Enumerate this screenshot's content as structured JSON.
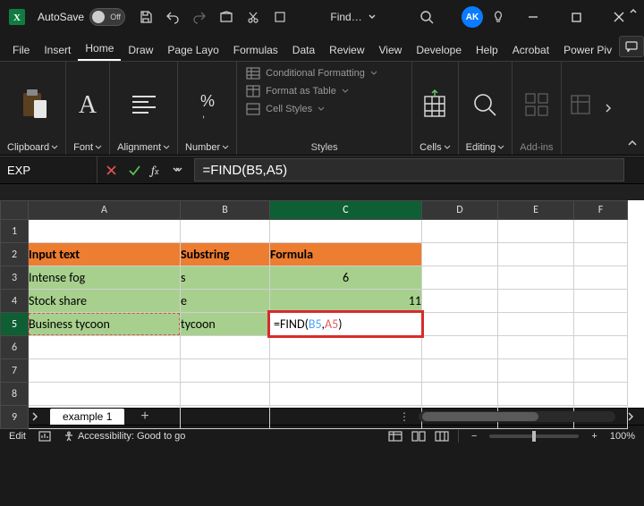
{
  "titlebar": {
    "autosave_label": "AutoSave",
    "autosave_state": "Off",
    "doc_title": "Find…",
    "user_initials": "AK"
  },
  "tabs": {
    "items": [
      "File",
      "Insert",
      "Home",
      "Draw",
      "Page Layo",
      "Formulas",
      "Data",
      "Review",
      "View",
      "Develope",
      "Help",
      "Acrobat",
      "Power Piv"
    ],
    "active_index": 2
  },
  "ribbon": {
    "clipboard": "Clipboard",
    "font": "Font",
    "alignment": "Alignment",
    "number": "Number",
    "styles_label": "Styles",
    "cond_fmt": "Conditional Formatting",
    "fmt_table": "Format as Table",
    "cell_styles": "Cell Styles",
    "cells": "Cells",
    "editing": "Editing",
    "addins": "Add-ins"
  },
  "namebox": {
    "value": "EXP"
  },
  "formula_bar": {
    "value": "=FIND(B5,A5)"
  },
  "grid": {
    "columns": [
      "A",
      "B",
      "C",
      "D",
      "E",
      "F"
    ],
    "active_col_index": 2,
    "active_row": 5,
    "headers": {
      "a": "Input text",
      "b": "Substring",
      "c": "Formula"
    },
    "rows": [
      {
        "a": "Intense fog",
        "b": "s",
        "c": "6"
      },
      {
        "a": "Stock share",
        "b": "e",
        "c": "11"
      },
      {
        "a": "Business tycoon",
        "b": "tycoon",
        "c_formula": {
          "prefix": "=FIND(",
          "ref1": "B5",
          "comma": ",",
          "ref2": "A5",
          "suffix": ")"
        }
      }
    ]
  },
  "sheet_tab": {
    "name": "example 1"
  },
  "status": {
    "mode": "Edit",
    "accessibility": "Accessibility: Good to go",
    "zoom": "100%"
  }
}
